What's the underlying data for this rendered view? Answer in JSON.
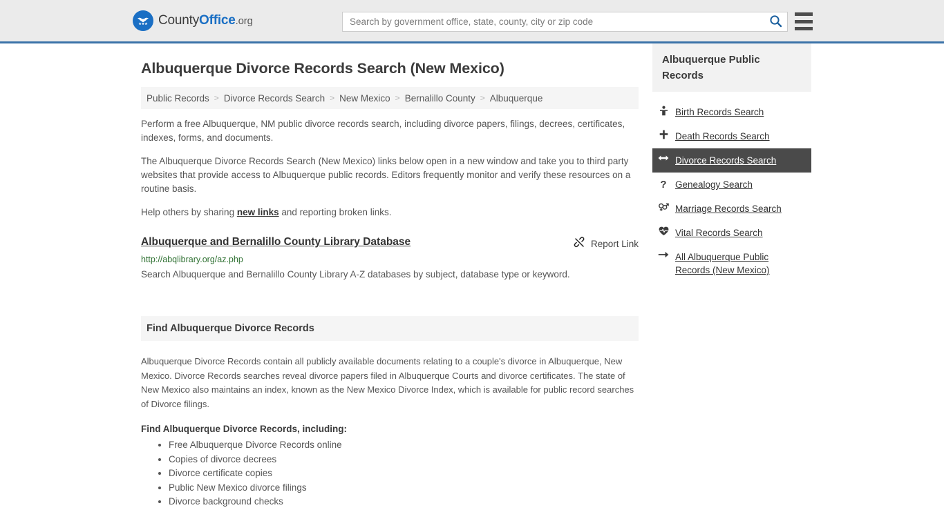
{
  "header": {
    "logo": {
      "prefix": "County",
      "bold": "Office",
      "suffix": ".org",
      "icon": "eagle-stars-seal-icon"
    },
    "search": {
      "placeholder": "Search by government office, state, county, city or zip code",
      "value": "",
      "button_icon": "search-icon"
    },
    "menu_icon": "hamburger-menu-icon"
  },
  "main": {
    "title": "Albuquerque Divorce Records Search (New Mexico)",
    "breadcrumb": [
      "Public Records",
      "Divorce Records Search",
      "New Mexico",
      "Bernalillo County",
      "Albuquerque"
    ],
    "breadcrumb_separator": ">",
    "paragraphs": {
      "p1": "Perform a free Albuquerque, NM public divorce records search, including divorce papers, filings, decrees, certificates, indexes, forms, and documents.",
      "p2": "The Albuquerque Divorce Records Search (New Mexico) links below open in a new window and take you to third party websites that provide access to Albuquerque public records. Editors frequently monitor and verify these resources on a routine basis.",
      "p3_before": "Help others by sharing ",
      "p3_link": "new links",
      "p3_after": " and reporting broken links."
    },
    "result": {
      "title": "Albuquerque and Bernalillo County Library Database",
      "url": "http://abqlibrary.org/az.php",
      "description": "Search Albuquerque and Bernalillo County Library A-Z databases by subject, database type or keyword.",
      "report_label": "Report Link",
      "report_icon": "broken-link-icon"
    },
    "section": {
      "heading": "Find Albuquerque Divorce Records",
      "body": "Albuquerque Divorce Records contain all publicly available documents relating to a couple's divorce in Albuquerque, New Mexico. Divorce Records searches reveal divorce papers filed in Albuquerque Courts and divorce certificates. The state of New Mexico also maintains an index, known as the New Mexico Divorce Index, which is available for public record searches of Divorce filings.",
      "sub_heading": "Find Albuquerque Divorce Records, including:",
      "bullets": [
        "Free Albuquerque Divorce Records online",
        "Copies of divorce decrees",
        "Divorce certificate copies",
        "Public New Mexico divorce filings",
        "Divorce background checks"
      ]
    }
  },
  "sidebar": {
    "heading": "Albuquerque Public Records",
    "items": [
      {
        "label": "Birth Records Search",
        "icon": "baby-icon",
        "glyph": "\u0001",
        "active": false
      },
      {
        "label": "Death Records Search",
        "icon": "cross-icon",
        "glyph": "✙",
        "active": false
      },
      {
        "label": "Divorce Records Search",
        "icon": "left-right-arrow-icon",
        "glyph": "↔",
        "active": true
      },
      {
        "label": "Genealogy Search",
        "icon": "question-mark-icon",
        "glyph": "?",
        "active": false
      },
      {
        "label": "Marriage Records Search",
        "icon": "venus-mars-icon",
        "glyph": "⚥",
        "active": false
      },
      {
        "label": "Vital Records Search",
        "icon": "heart-pulse-icon",
        "glyph": "♥",
        "active": false
      },
      {
        "label": "All Albuquerque Public Records (New Mexico)",
        "icon": "arrow-right-icon",
        "glyph": "→",
        "active": false
      }
    ]
  },
  "colors": {
    "brand_blue": "#1a6fc4",
    "header_border": "#3a72a8",
    "header_bg": "#ebebeb",
    "panel_bg": "#f5f5f5",
    "active_bg": "#4a4a4a",
    "url_green": "#2e7031",
    "text": "#555555"
  }
}
